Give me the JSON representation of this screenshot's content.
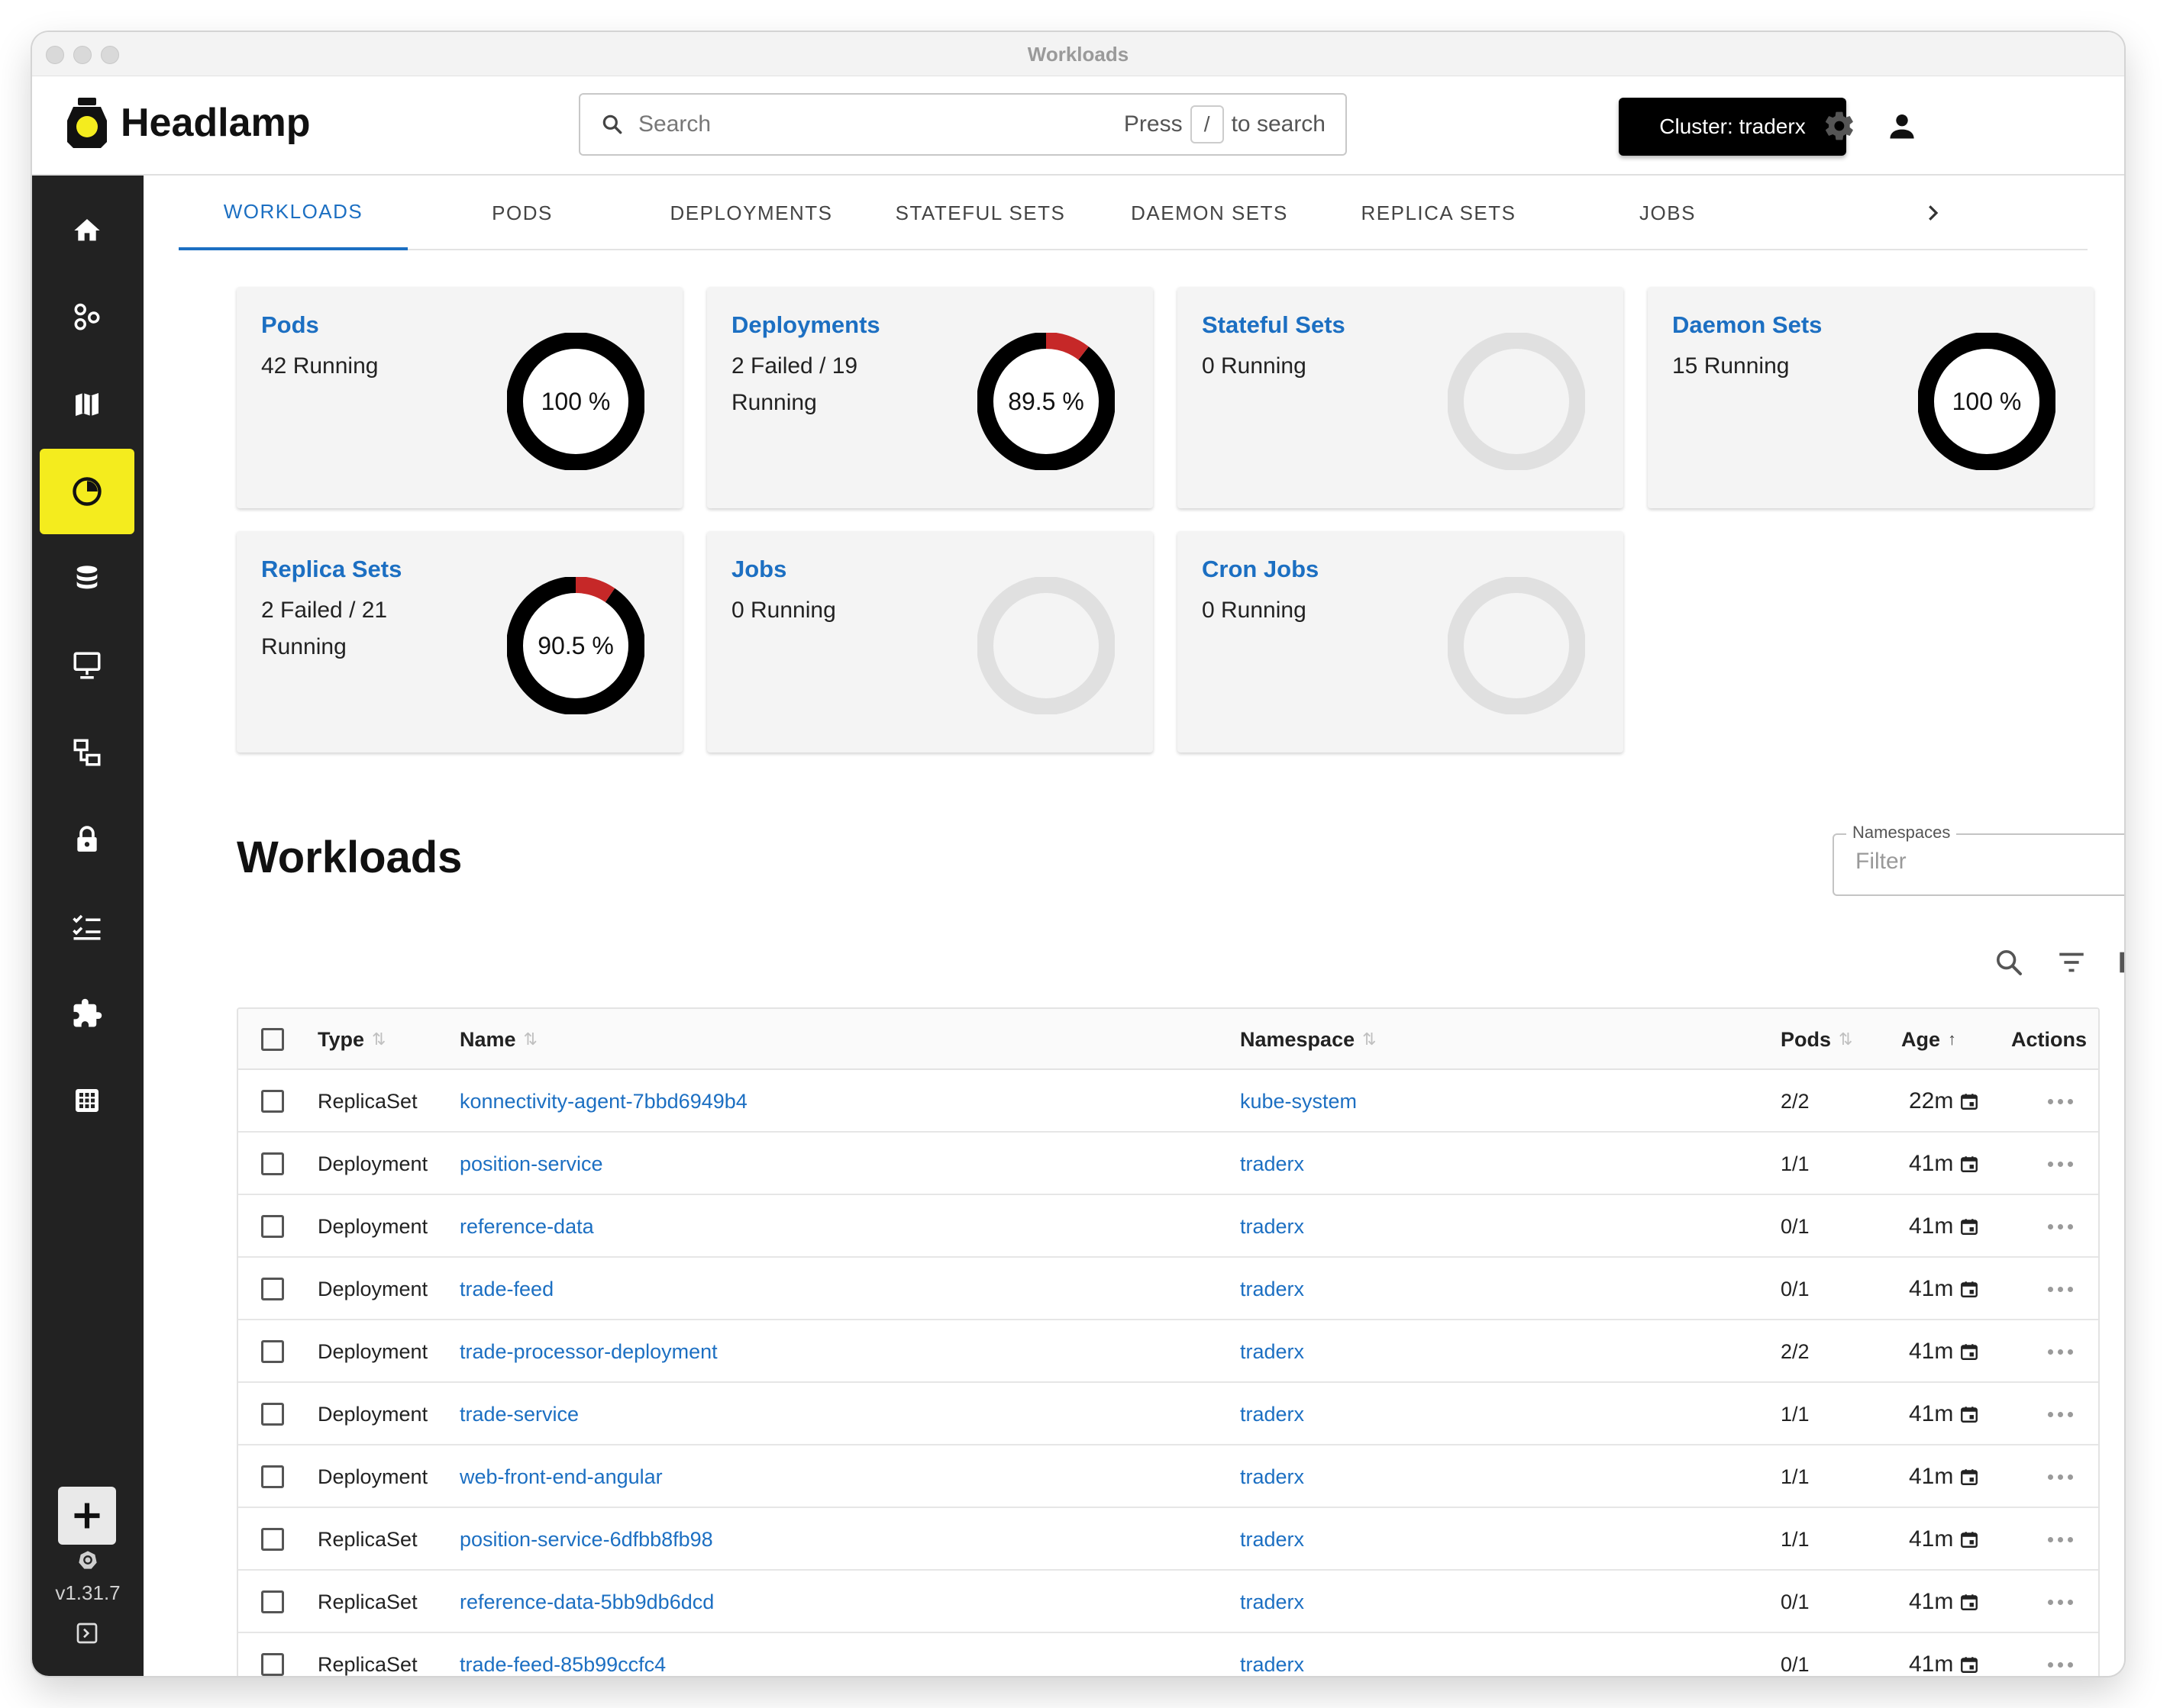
{
  "window": {
    "title": "Workloads"
  },
  "app": {
    "name": "Headlamp",
    "search": {
      "placeholder": "Search",
      "hint_prefix": "Press",
      "hint_key": "/",
      "hint_suffix": "to search"
    },
    "cluster_button": "Cluster: traderx"
  },
  "sidebar": {
    "items": [
      {
        "icon": "home-icon"
      },
      {
        "icon": "cluster-nodes-icon"
      },
      {
        "icon": "map-icon"
      },
      {
        "icon": "workloads-icon",
        "active": true
      },
      {
        "icon": "storage-icon"
      },
      {
        "icon": "network-icon"
      },
      {
        "icon": "gateway-icon"
      },
      {
        "icon": "security-icon"
      },
      {
        "icon": "configuration-icon"
      },
      {
        "icon": "extensions-icon"
      },
      {
        "icon": "apps-icon"
      }
    ],
    "version": "v1.31.7"
  },
  "tabs": [
    "WORKLOADS",
    "PODS",
    "DEPLOYMENTS",
    "STATEFUL SETS",
    "DAEMON SETS",
    "REPLICA SETS",
    "JOBS"
  ],
  "cards": [
    {
      "title": "Pods",
      "lines": [
        "42 Running"
      ],
      "percent_label": "100 %",
      "success": 1.0,
      "empty": false
    },
    {
      "title": "Deployments",
      "lines": [
        "2 Failed / 19",
        "Running"
      ],
      "percent_label": "89.5 %",
      "success": 0.895,
      "empty": false
    },
    {
      "title": "Stateful Sets",
      "lines": [
        "0 Running"
      ],
      "percent_label": "",
      "success": 0,
      "empty": true
    },
    {
      "title": "Daemon Sets",
      "lines": [
        "15 Running"
      ],
      "percent_label": "100 %",
      "success": 1.0,
      "empty": false
    },
    {
      "title": "Replica Sets",
      "lines": [
        "2 Failed / 21",
        "Running"
      ],
      "percent_label": "90.5 %",
      "success": 0.905,
      "empty": false
    },
    {
      "title": "Jobs",
      "lines": [
        "0 Running"
      ],
      "percent_label": "",
      "success": 0,
      "empty": true
    },
    {
      "title": "Cron Jobs",
      "lines": [
        "0 Running"
      ],
      "percent_label": "",
      "success": 0,
      "empty": true
    }
  ],
  "colors": {
    "accent": "#1c6fc2",
    "active_nav": "#f4ec1e",
    "ring_ok": "#000000",
    "ring_fail": "#c62828",
    "ring_empty": "#e0e0e0"
  },
  "workloads": {
    "title": "Workloads",
    "namespaces": {
      "label": "Namespaces",
      "placeholder": "Filter"
    },
    "columns": {
      "type": "Type",
      "name": "Name",
      "namespace": "Namespace",
      "pods": "Pods",
      "age": "Age",
      "actions": "Actions"
    },
    "rows": [
      {
        "type": "ReplicaSet",
        "name": "konnectivity-agent-7bbd6949b4",
        "namespace": "kube-system",
        "pods": "2/2",
        "age": "22m"
      },
      {
        "type": "Deployment",
        "name": "position-service",
        "namespace": "traderx",
        "pods": "1/1",
        "age": "41m"
      },
      {
        "type": "Deployment",
        "name": "reference-data",
        "namespace": "traderx",
        "pods": "0/1",
        "age": "41m"
      },
      {
        "type": "Deployment",
        "name": "trade-feed",
        "namespace": "traderx",
        "pods": "0/1",
        "age": "41m"
      },
      {
        "type": "Deployment",
        "name": "trade-processor-deployment",
        "namespace": "traderx",
        "pods": "2/2",
        "age": "41m"
      },
      {
        "type": "Deployment",
        "name": "trade-service",
        "namespace": "traderx",
        "pods": "1/1",
        "age": "41m"
      },
      {
        "type": "Deployment",
        "name": "web-front-end-angular",
        "namespace": "traderx",
        "pods": "1/1",
        "age": "41m"
      },
      {
        "type": "ReplicaSet",
        "name": "position-service-6dfbb8fb98",
        "namespace": "traderx",
        "pods": "1/1",
        "age": "41m"
      },
      {
        "type": "ReplicaSet",
        "name": "reference-data-5bb9db6dcd",
        "namespace": "traderx",
        "pods": "0/1",
        "age": "41m"
      },
      {
        "type": "ReplicaSet",
        "name": "trade-feed-85b99ccfc4",
        "namespace": "traderx",
        "pods": "0/1",
        "age": "41m"
      }
    ]
  }
}
